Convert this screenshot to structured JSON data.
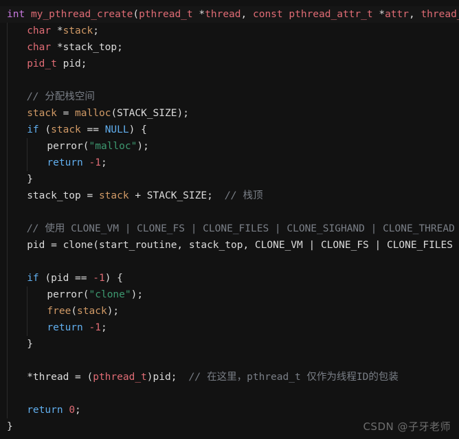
{
  "editor": {
    "background": "#121212",
    "highlight_line_background": "#161616",
    "font_size_px": 14.5,
    "line_height_px": 24,
    "language": "c"
  },
  "theme_colors": {
    "keyword": "#c678dd",
    "function_definition": "#e06c75",
    "type": "#e06c75",
    "plain_text": "#dcdcdc",
    "variable": "#d19a66",
    "function_call": "#d19a66",
    "control_keyword": "#61afef",
    "constant": "#61afef",
    "number": "#e06c75",
    "string": "#3d9970",
    "comment": "#7a7f87",
    "indent_guide": "#2b2b2b",
    "watermark": "#6e6e6e"
  },
  "watermark": {
    "text": "CSDN @子牙老师"
  },
  "code": {
    "lines": [
      {
        "n": 1,
        "highlight": true,
        "indent": 0,
        "tokens": [
          {
            "c": "t-kw",
            "v": "int"
          },
          {
            "c": "t-plain",
            "v": " "
          },
          {
            "c": "t-fn-def",
            "v": "my_pthread_create"
          },
          {
            "c": "t-plain",
            "v": "("
          },
          {
            "c": "t-type",
            "v": "pthread_t"
          },
          {
            "c": "t-plain",
            "v": " *"
          },
          {
            "c": "t-param",
            "v": "thread"
          },
          {
            "c": "t-plain",
            "v": ", "
          },
          {
            "c": "t-type",
            "v": "const"
          },
          {
            "c": "t-plain",
            "v": " "
          },
          {
            "c": "t-type",
            "v": "pthread_attr_t"
          },
          {
            "c": "t-plain",
            "v": " *"
          },
          {
            "c": "t-param",
            "v": "attr"
          },
          {
            "c": "t-plain",
            "v": ", "
          },
          {
            "c": "t-type",
            "v": "thread_func_t"
          }
        ]
      },
      {
        "n": 2,
        "highlight": false,
        "indent": 1,
        "tokens": [
          {
            "c": "t-type",
            "v": "char"
          },
          {
            "c": "t-plain",
            "v": " *"
          },
          {
            "c": "t-var",
            "v": "stack"
          },
          {
            "c": "t-plain",
            "v": ";"
          }
        ]
      },
      {
        "n": 3,
        "highlight": false,
        "indent": 1,
        "tokens": [
          {
            "c": "t-type",
            "v": "char"
          },
          {
            "c": "t-plain",
            "v": " *"
          },
          {
            "c": "t-plain",
            "v": "stack_top"
          },
          {
            "c": "t-plain",
            "v": ";"
          }
        ]
      },
      {
        "n": 4,
        "highlight": false,
        "indent": 1,
        "tokens": [
          {
            "c": "t-type",
            "v": "pid_t"
          },
          {
            "c": "t-plain",
            "v": " pid;"
          }
        ]
      },
      {
        "n": 5,
        "highlight": false,
        "indent": 1,
        "tokens": []
      },
      {
        "n": 6,
        "highlight": false,
        "indent": 1,
        "tokens": [
          {
            "c": "t-cmt-i",
            "v": "// "
          },
          {
            "c": "t-cmt",
            "v": "分配栈空间"
          }
        ]
      },
      {
        "n": 7,
        "highlight": false,
        "indent": 1,
        "tokens": [
          {
            "c": "t-var",
            "v": "stack"
          },
          {
            "c": "t-plain",
            "v": " = "
          },
          {
            "c": "t-call",
            "v": "malloc"
          },
          {
            "c": "t-plain",
            "v": "(STACK_SIZE);"
          }
        ]
      },
      {
        "n": 8,
        "highlight": false,
        "indent": 1,
        "tokens": [
          {
            "c": "t-ctl",
            "v": "if"
          },
          {
            "c": "t-plain",
            "v": " ("
          },
          {
            "c": "t-var",
            "v": "stack"
          },
          {
            "c": "t-plain",
            "v": " == "
          },
          {
            "c": "t-const",
            "v": "NULL"
          },
          {
            "c": "t-plain",
            "v": ") {"
          }
        ]
      },
      {
        "n": 9,
        "highlight": false,
        "indent": 2,
        "tokens": [
          {
            "c": "t-fnwhite",
            "v": "perror"
          },
          {
            "c": "t-plain",
            "v": "("
          },
          {
            "c": "t-str",
            "v": "\"malloc\""
          },
          {
            "c": "t-plain",
            "v": ");"
          }
        ]
      },
      {
        "n": 10,
        "highlight": false,
        "indent": 2,
        "tokens": [
          {
            "c": "t-ctl",
            "v": "return"
          },
          {
            "c": "t-plain",
            "v": " "
          },
          {
            "c": "t-num",
            "v": "-1"
          },
          {
            "c": "t-plain",
            "v": ";"
          }
        ]
      },
      {
        "n": 11,
        "highlight": false,
        "indent": 1,
        "tokens": [
          {
            "c": "t-plain",
            "v": "}"
          }
        ]
      },
      {
        "n": 12,
        "highlight": false,
        "indent": 1,
        "tokens": [
          {
            "c": "t-plain",
            "v": "stack_top = "
          },
          {
            "c": "t-var",
            "v": "stack"
          },
          {
            "c": "t-plain",
            "v": " + STACK_SIZE;  "
          },
          {
            "c": "t-cmt-i",
            "v": "// "
          },
          {
            "c": "t-cmt",
            "v": "栈顶"
          }
        ]
      },
      {
        "n": 13,
        "highlight": false,
        "indent": 1,
        "tokens": []
      },
      {
        "n": 14,
        "highlight": false,
        "indent": 1,
        "tokens": [
          {
            "c": "t-cmt-i",
            "v": "// "
          },
          {
            "c": "t-cmt",
            "v": "使用 CLONE_VM | CLONE_FS | CLONE_FILES | CLONE_SIGHAND | CLONE_THREAD 标志"
          }
        ]
      },
      {
        "n": 15,
        "highlight": false,
        "indent": 1,
        "tokens": [
          {
            "c": "t-plain",
            "v": "pid = clone(start_routine, stack_top, CLONE_VM | CLONE_FS | CLONE_FILES | CLON"
          }
        ]
      },
      {
        "n": 16,
        "highlight": false,
        "indent": 1,
        "tokens": []
      },
      {
        "n": 17,
        "highlight": false,
        "indent": 1,
        "tokens": [
          {
            "c": "t-ctl",
            "v": "if"
          },
          {
            "c": "t-plain",
            "v": " (pid == "
          },
          {
            "c": "t-num",
            "v": "-1"
          },
          {
            "c": "t-plain",
            "v": ") {"
          }
        ]
      },
      {
        "n": 18,
        "highlight": false,
        "indent": 2,
        "tokens": [
          {
            "c": "t-fnwhite",
            "v": "perror"
          },
          {
            "c": "t-plain",
            "v": "("
          },
          {
            "c": "t-str",
            "v": "\"clone\""
          },
          {
            "c": "t-plain",
            "v": ");"
          }
        ]
      },
      {
        "n": 19,
        "highlight": false,
        "indent": 2,
        "tokens": [
          {
            "c": "t-call",
            "v": "free"
          },
          {
            "c": "t-plain",
            "v": "("
          },
          {
            "c": "t-var",
            "v": "stack"
          },
          {
            "c": "t-plain",
            "v": ");"
          }
        ]
      },
      {
        "n": 20,
        "highlight": false,
        "indent": 2,
        "tokens": [
          {
            "c": "t-ctl",
            "v": "return"
          },
          {
            "c": "t-plain",
            "v": " "
          },
          {
            "c": "t-num",
            "v": "-1"
          },
          {
            "c": "t-plain",
            "v": ";"
          }
        ]
      },
      {
        "n": 21,
        "highlight": false,
        "indent": 1,
        "tokens": [
          {
            "c": "t-plain",
            "v": "}"
          }
        ]
      },
      {
        "n": 22,
        "highlight": false,
        "indent": 1,
        "tokens": []
      },
      {
        "n": 23,
        "highlight": false,
        "indent": 1,
        "tokens": [
          {
            "c": "t-plain",
            "v": "*thread = ("
          },
          {
            "c": "t-type",
            "v": "pthread_t"
          },
          {
            "c": "t-plain",
            "v": ")pid;  "
          },
          {
            "c": "t-cmt-i",
            "v": "// "
          },
          {
            "c": "t-cmt",
            "v": "在这里，pthread_t 仅作为线程ID的包装"
          }
        ]
      },
      {
        "n": 24,
        "highlight": false,
        "indent": 1,
        "tokens": []
      },
      {
        "n": 25,
        "highlight": false,
        "indent": 1,
        "tokens": [
          {
            "c": "t-ctl",
            "v": "return"
          },
          {
            "c": "t-plain",
            "v": " "
          },
          {
            "c": "t-num",
            "v": "0"
          },
          {
            "c": "t-plain",
            "v": ";"
          }
        ]
      },
      {
        "n": 26,
        "highlight": false,
        "indent": 0,
        "tokens": [
          {
            "c": "t-plain",
            "v": "}"
          }
        ]
      }
    ]
  }
}
